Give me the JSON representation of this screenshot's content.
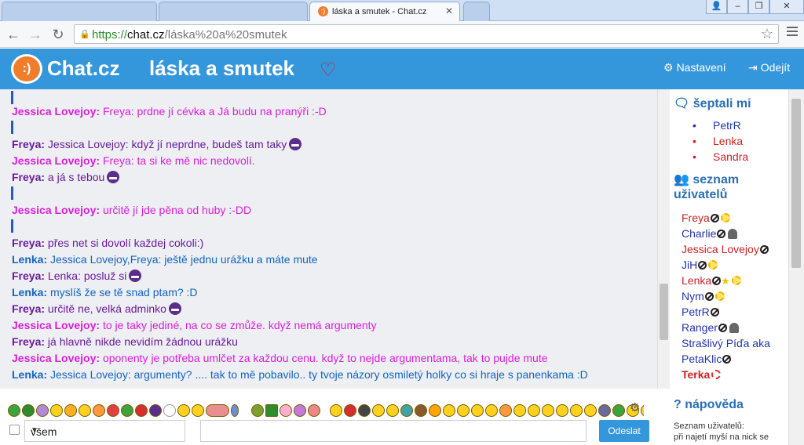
{
  "browser": {
    "active_tab_title": "láska a smutek - Chat.cz",
    "url_scheme": "https://",
    "url_host": "chat.cz",
    "url_path": "/láska%20a%20smutek"
  },
  "header": {
    "logo_text": "Chat.cz",
    "logo_mark": ":)",
    "room_title": "láska a smutek",
    "settings_label": "Nastavení",
    "logout_label": "Odejít"
  },
  "messages": [
    {
      "nick": "Jessica Lovejoy:",
      "text": " Freya: prdne jí cévka a Já budu na pranýři :-D",
      "color": "pink"
    },
    {
      "nick": "Freya:",
      "text": " Jessica Lovejoy: když jí neprdne, budeš tam taky",
      "color": "purple",
      "emoji": true
    },
    {
      "nick": "Jessica Lovejoy:",
      "text": " Freya: ta si ke mě nic nedovolí.",
      "color": "pink"
    },
    {
      "nick": "Freya:",
      "text": " a já s tebou",
      "color": "purple",
      "emoji": true
    },
    {
      "nick": "Jessica Lovejoy:",
      "text": " určitě jí jde pěna od huby :-DD",
      "color": "pink"
    },
    {
      "nick": "Freya:",
      "text": " přes net si dovolí každej cokoli:)",
      "color": "purple"
    },
    {
      "nick": "Lenka:",
      "text": " Jessica Lovejoy,Freya: ještě jednu urážku a máte mute",
      "color": "blue"
    },
    {
      "nick": "Freya:",
      "text": " Lenka: posluž si",
      "color": "purple",
      "emoji": true
    },
    {
      "nick": "Lenka:",
      "text": " myslíš že se tě snad ptam? :D",
      "color": "blue"
    },
    {
      "nick": "Freya:",
      "text": " určitě ne, velká adminko",
      "color": "purple",
      "emoji": true
    },
    {
      "nick": "Jessica Lovejoy:",
      "text": " to je taky jediné, na co se zmůže. když nemá argumenty",
      "color": "pink"
    },
    {
      "nick": "Freya:",
      "text": " já hlavně nikde nevidím žádnou urážku",
      "color": "purple"
    },
    {
      "nick": "Jessica Lovejoy:",
      "text": " oponenty je potřeba umlčet za každou cenu. když to nejde argumentama, tak to pujde mute",
      "color": "pink"
    },
    {
      "nick": "Lenka:",
      "text": " Jessica Lovejoy: argumenty? .... tak to mě pobavilo.. ty tvoje názory osmiletý holky co si hraje s panenkama :D",
      "color": "blue"
    }
  ],
  "sidebar": {
    "whispers_title": "šeptali mi",
    "whispers": [
      {
        "name": "PetrR",
        "color": "#2233aa"
      },
      {
        "name": "Lenka",
        "color": "#cc2222"
      },
      {
        "name": "Sandra",
        "color": "#cc2222"
      }
    ],
    "users_title": "seznam uživatelů",
    "users": [
      {
        "name": "Freya",
        "color": "#cc2222"
      },
      {
        "name": "Charlie",
        "color": "#2233aa"
      },
      {
        "name": "Jessica Lovejoy",
        "color": "#cc2222"
      },
      {
        "name": "JiH",
        "color": "#2233aa"
      },
      {
        "name": "Lenka",
        "color": "#cc2222"
      },
      {
        "name": "Nym",
        "color": "#2233aa"
      },
      {
        "name": "PetrR",
        "color": "#2233aa"
      },
      {
        "name": "Ranger",
        "color": "#2233aa"
      },
      {
        "name": "Strašlivý Píďa aka",
        "color": "#2233aa"
      },
      {
        "name": "PetaKlic",
        "color": "#2233aa"
      },
      {
        "name": "Terka",
        "color": "#cc2222"
      }
    ],
    "help_title": "nápověda",
    "help_line1": "Seznam uživatelů:",
    "help_line2": "při najetí myší na nick se"
  },
  "composer": {
    "recipient": "všem",
    "send_label": "Odeslat"
  },
  "colors": {
    "brand_blue": "#3597db",
    "pink": "#d91ed9",
    "purple": "#6a1b9a",
    "blue": "#1565c0"
  }
}
